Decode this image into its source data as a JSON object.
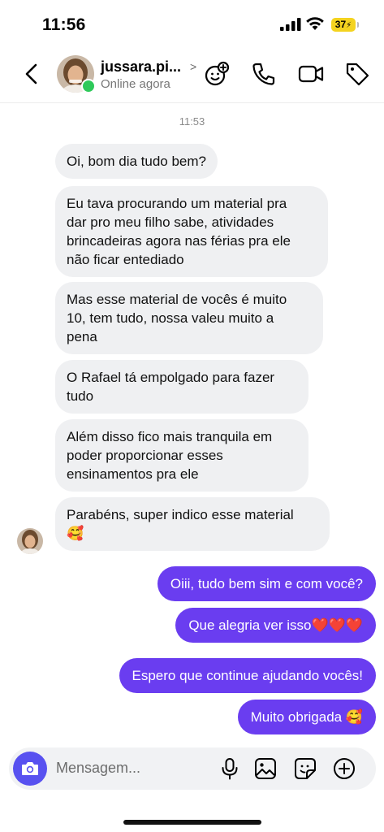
{
  "status_bar": {
    "time": "11:56",
    "battery": "37"
  },
  "header": {
    "contact_name": "jussara.pi...",
    "status": "Online agora",
    "icons": [
      "back-arrow-icon",
      "sticker-face-icon",
      "phone-icon",
      "video-icon",
      "tag-icon"
    ]
  },
  "chat": {
    "timestamp": "11:53",
    "incoming": [
      {
        "text": "Oi, bom dia tudo bem?"
      },
      {
        "text": "Eu tava procurando um material pra\ndar pro meu filho sabe, atividades\nbrincadeiras agora nas férias pra ele\nnão ficar entediado"
      },
      {
        "text": "Mas esse material de vocês é muito\n10, tem tudo, nossa valeu muito a\npena"
      },
      {
        "text": "O Rafael tá empolgado para fazer\ntudo"
      },
      {
        "text": "Além disso fico mais tranquila em\npoder proporcionar esses\nensinamentos pra ele"
      },
      {
        "text": "Parabéns, super indico esse material\n🥰"
      }
    ],
    "outgoing": [
      {
        "text": "Oiii, tudo bem sim e com você?"
      },
      {
        "text": "Que alegria ver isso❤️❤️❤️"
      },
      {
        "text": "Espero que continue ajudando vocês!"
      },
      {
        "text": "Muito obrigada 🥰"
      }
    ]
  },
  "composer": {
    "placeholder": "Mensagem...",
    "icons": [
      "camera-icon",
      "microphone-icon",
      "image-icon",
      "sticker-icon",
      "plus-circle-icon"
    ]
  },
  "colors": {
    "outgoing_bubble": "#6a3df0",
    "incoming_bubble": "#eff0f2",
    "online": "#2ec95a",
    "camera_button": "#5851f0"
  }
}
